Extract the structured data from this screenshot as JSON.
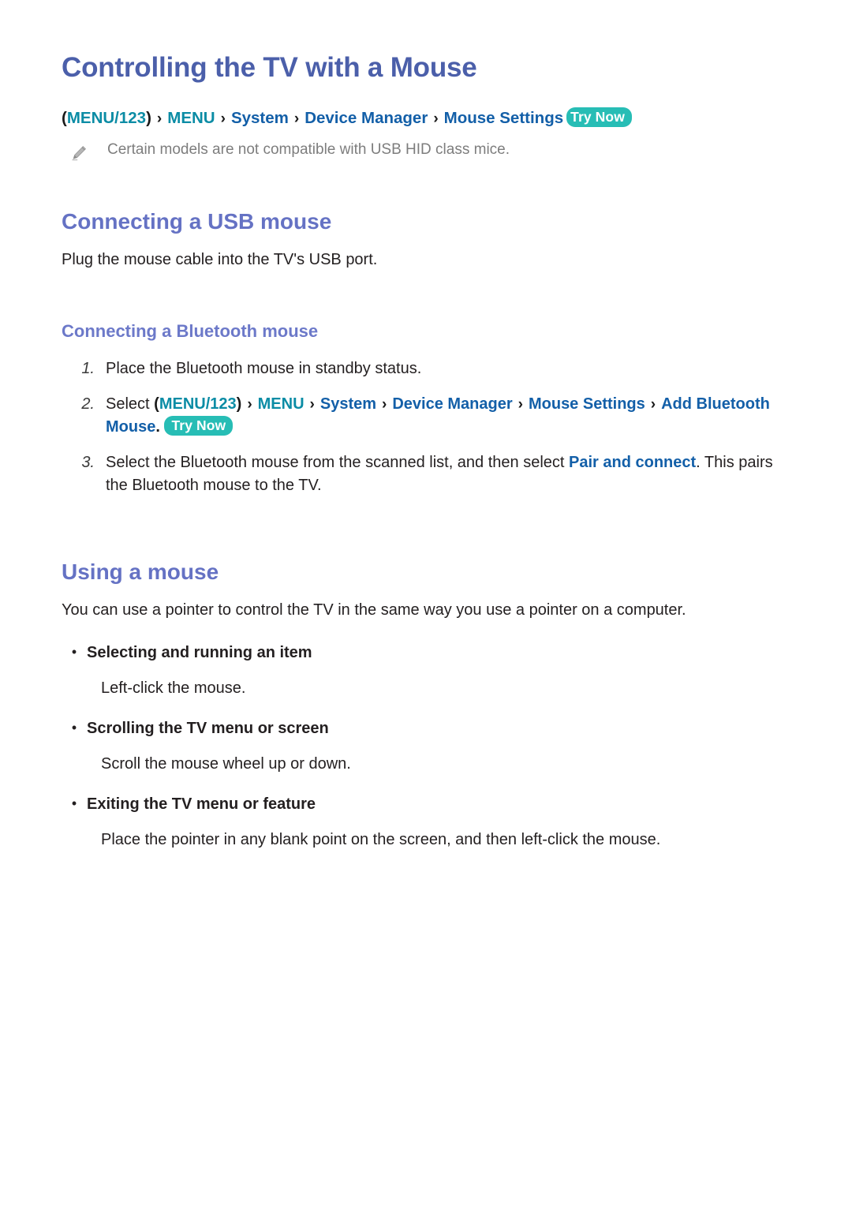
{
  "page": {
    "title": "Controlling the TV with a Mouse",
    "background_color": "#ffffff"
  },
  "colors": {
    "title": "#4b5faa",
    "heading": "#6572c4",
    "subheading": "#6c79c9",
    "crumb_teal": "#0b8ca5",
    "crumb_blue": "#135fa8",
    "badge_bg": "#27bdb5",
    "badge_text": "#ffffff",
    "note_text": "#7d7d7d",
    "body_text": "#231f20"
  },
  "breadcrumb": {
    "open_paren": "(",
    "menu123": "MENU/123",
    "close_paren": ")",
    "separator": "›",
    "menu": "MENU",
    "system": "System",
    "device_manager": "Device Manager",
    "mouse_settings": "Mouse Settings",
    "try_now": "Try Now"
  },
  "note": {
    "icon": "pencil-icon",
    "text": "Certain models are not compatible with USB HID class mice."
  },
  "sections": {
    "usb": {
      "heading": "Connecting a USB mouse",
      "body": "Plug the mouse cable into the TV's USB port."
    },
    "bluetooth": {
      "heading": "Connecting a Bluetooth mouse",
      "steps": [
        {
          "num": "1.",
          "text": "Place the Bluetooth mouse in standby status."
        },
        {
          "num": "2.",
          "lead": "Select ",
          "open_paren": "(",
          "menu123": "MENU/123",
          "close_paren": ")",
          "separator": "›",
          "menu": "MENU",
          "system": "System",
          "device_manager": "Device Manager",
          "mouse_settings": "Mouse Settings",
          "add_bluetooth_mouse": "Add Bluetooth Mouse",
          "period": ".",
          "try_now": "Try Now"
        },
        {
          "num": "3.",
          "part1": "Select the Bluetooth mouse from the scanned list, and then select ",
          "link": "Pair and connect",
          "part2": ". This pairs the Bluetooth mouse to the TV."
        }
      ]
    },
    "using": {
      "heading": "Using a mouse",
      "intro": "You can use a pointer to control the TV in the same way you use a pointer on a computer.",
      "bullet_glyph": "•",
      "items": [
        {
          "title": "Selecting and running an item",
          "body": "Left-click the mouse."
        },
        {
          "title": "Scrolling the TV menu or screen",
          "body": "Scroll the mouse wheel up or down."
        },
        {
          "title": "Exiting the TV menu or feature",
          "body": "Place the pointer in any blank point on the screen, and then left-click the mouse."
        }
      ]
    }
  }
}
